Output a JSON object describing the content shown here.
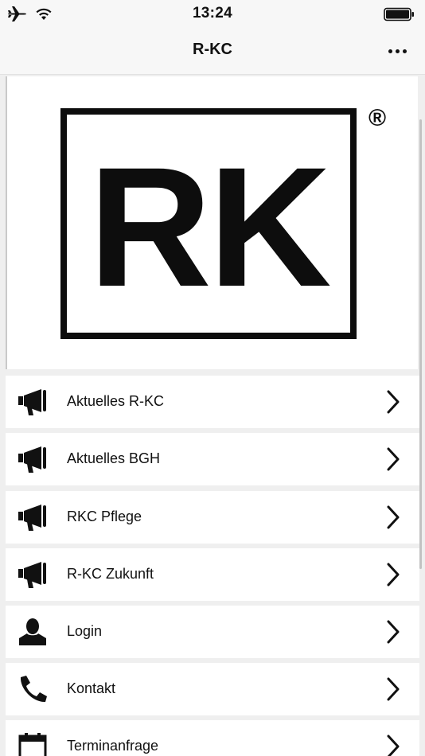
{
  "status_bar": {
    "time": "13:24"
  },
  "nav": {
    "title": "R-KC"
  },
  "logo": {
    "text": "RK",
    "registered_mark": "®"
  },
  "menu": [
    {
      "label": "Aktuelles R-KC",
      "icon": "megaphone-icon"
    },
    {
      "label": "Aktuelles BGH",
      "icon": "megaphone-icon"
    },
    {
      "label": "RKC Pflege",
      "icon": "megaphone-icon"
    },
    {
      "label": "R-KC Zukunft",
      "icon": "megaphone-icon"
    },
    {
      "label": "Login",
      "icon": "user-icon"
    },
    {
      "label": "Kontakt",
      "icon": "phone-icon"
    },
    {
      "label": "Terminanfrage",
      "icon": "calendar-icon"
    }
  ]
}
